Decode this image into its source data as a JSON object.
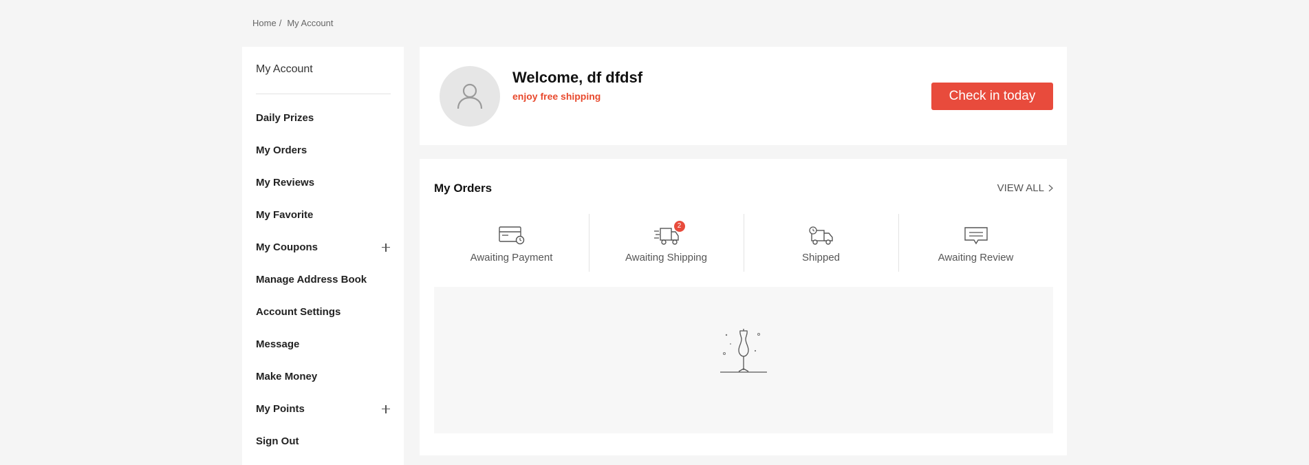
{
  "breadcrumb": {
    "home": "Home",
    "separator": "/",
    "current": "My Account"
  },
  "sidebar": {
    "title": "My Account",
    "items": [
      {
        "label": "Daily Prizes",
        "expandable": false
      },
      {
        "label": "My Orders",
        "expandable": false
      },
      {
        "label": "My Reviews",
        "expandable": false
      },
      {
        "label": "My Favorite",
        "expandable": false
      },
      {
        "label": "My Coupons",
        "expandable": true
      },
      {
        "label": "Manage Address Book",
        "expandable": false
      },
      {
        "label": "Account Settings",
        "expandable": false
      },
      {
        "label": "Message",
        "expandable": false
      },
      {
        "label": "Make Money",
        "expandable": false
      },
      {
        "label": "My Points",
        "expandable": true
      },
      {
        "label": "Sign Out",
        "expandable": false
      }
    ]
  },
  "welcome": {
    "title": "Welcome, df dfdsf",
    "subtitle": "enjoy free shipping",
    "checkin_label": "Check in today"
  },
  "orders": {
    "title": "My Orders",
    "view_all_label": "VIEW ALL",
    "statuses": [
      {
        "label": "Awaiting Payment",
        "icon": "card-clock-icon"
      },
      {
        "label": "Awaiting Shipping",
        "icon": "fast-truck-icon",
        "badge": "2"
      },
      {
        "label": "Shipped",
        "icon": "truck-clock-icon"
      },
      {
        "label": "Awaiting Review",
        "icon": "comment-icon"
      }
    ]
  },
  "colors": {
    "accent": "#e84b3c",
    "page_bg": "#f5f5f5",
    "card_bg": "#ffffff"
  }
}
